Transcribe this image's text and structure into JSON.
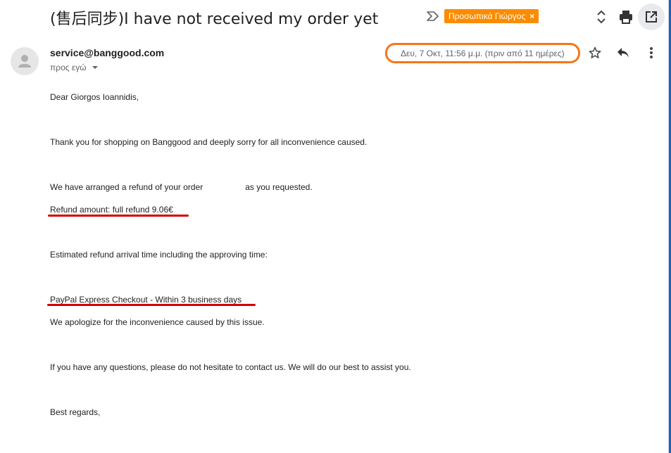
{
  "email": {
    "subject": "(售后同步)I have not received my order yet",
    "label": "Προσωπικά Γιώργος",
    "label_remove": "×",
    "sender": "service@banggood.com",
    "to_label": "προς εγώ",
    "date": "Δευ, 7 Οκτ, 11:56 μ.μ. (πριν από 11 ημέρες)"
  },
  "body": {
    "greeting": "Dear Giorgos Ioannidis,",
    "thanks": "Thank you for shopping on Banggood and deeply sorry for all inconvenience caused.",
    "refund_pre": "We have arranged a refund of your order",
    "refund_post": "as you requested.",
    "refund_amount": "Refund amount: full refund 9.06€",
    "estimated": "Estimated refund arrival time including the approving time:",
    "paypal": "PayPal Express Checkout - Within 3 business days",
    "apology": "We apologize for the inconvenience caused by this issue.",
    "questions": "If you have any questions, please do not hesitate to contact us. We will do our best to assist you.",
    "regards": "Best regards,"
  },
  "icons": [
    "importance-marker-icon",
    "expand-collapse-icon",
    "print-icon",
    "open-new-window-icon",
    "avatar-icon",
    "star-icon",
    "reply-icon",
    "more-options-icon"
  ],
  "colors": {
    "label_bg": "#fb8c00",
    "annotation_orange": "#f5761a",
    "annotation_red": "#d50000"
  }
}
